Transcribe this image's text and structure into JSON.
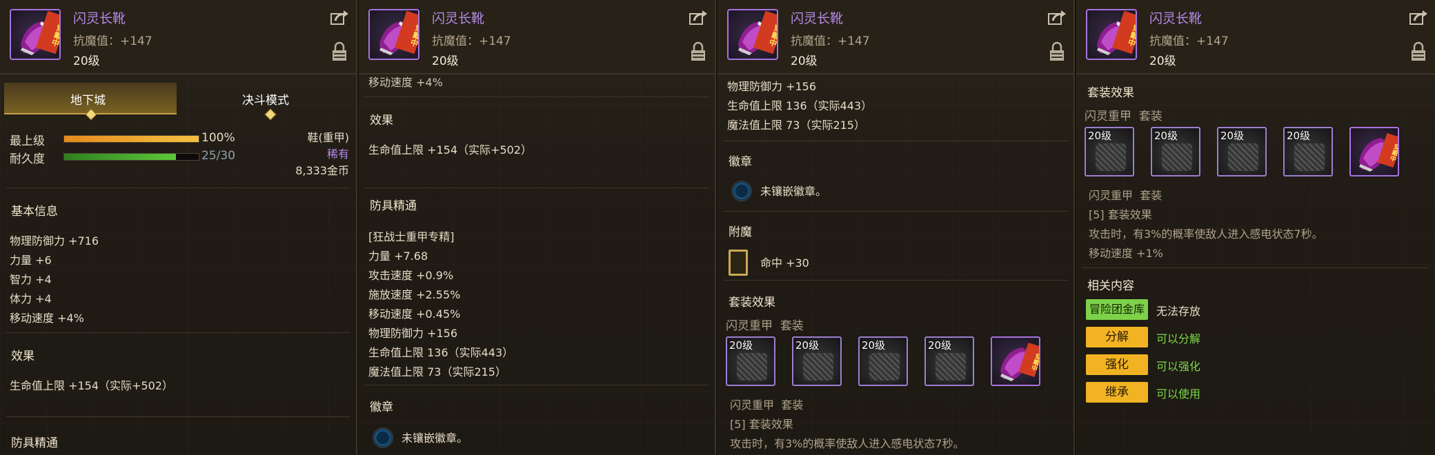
{
  "item": {
    "name": "闪灵长靴",
    "stat": "抗魔值：+147",
    "level": "20级",
    "equipped_tag": "穿戴中"
  },
  "colors": {
    "name": "#b58ae8",
    "rarity": "#b58ae8",
    "button_yellow": "#f2b323",
    "button_green": "#7ed14a",
    "positive_text": "#7cd94a"
  },
  "icons": [
    "shoe-icon",
    "share-icon",
    "lock-icon",
    "emblem-socket-icon",
    "enchant-card-icon"
  ],
  "panel1": {
    "tabs": [
      {
        "label": "地下城"
      },
      {
        "label": "决斗模式"
      }
    ],
    "grade_label": "最上级",
    "grade_value": "100%",
    "grade_fill": 1.0,
    "durability_label": "耐久度",
    "durability_value": "25/30",
    "durability_fill": 0.8333,
    "type": "鞋(重甲)",
    "rarity": "稀有",
    "price": "8,333金币",
    "basic_title": "基本信息",
    "basic_lines": [
      "物理防御力 +716",
      "力量 +6",
      "智力 +4",
      "体力 +4",
      "移动速度 +4%"
    ],
    "effect_title": "效果",
    "effect_line": "生命值上限 +154（实际+502）",
    "mastery_title": "防具精通"
  },
  "panel2": {
    "top_line": "移动速度 +4%",
    "effect_title": "效果",
    "effect_line": "生命值上限 +154（实际+502）",
    "mastery_title": "防具精通",
    "mastery_lines": [
      "[狂战士重甲专精]",
      "力量 +7.68",
      "攻击速度 +0.9%",
      "施放速度 +2.55%",
      "移动速度 +0.45%",
      "物理防御力 +156",
      "生命值上限 136（实际443）",
      "魔法值上限 73（实际215）"
    ],
    "emblem_title": "徽章",
    "emblem_line": "未镶嵌徽章。"
  },
  "panel3": {
    "top_lines": [
      "物理防御力 +156",
      "生命值上限 136（实际443）",
      "魔法值上限 73（实际215）"
    ],
    "emblem_title": "徽章",
    "emblem_line": "未镶嵌徽章。",
    "enchant_title": "附魔",
    "enchant_line": "命中 +30",
    "set_title": "套装效果",
    "set_name": "闪灵重甲",
    "set_suffix": "套装",
    "slot_levels": [
      "20级",
      "20级",
      "20级",
      "20级"
    ],
    "set_name2": "闪灵重甲",
    "set_suffix2": "套装",
    "set_effect": "[5] 套装效果",
    "set_desc": "攻击时，有3%的概率使敌人进入感电状态7秒。"
  },
  "panel4": {
    "set_title": "套装效果",
    "set_name": "闪灵重甲",
    "set_suffix": "套装",
    "slot_levels": [
      "20级",
      "20级",
      "20级",
      "20级"
    ],
    "set_name2": "闪灵重甲",
    "set_suffix2": "套装",
    "set_effect": "[5] 套装效果",
    "set_desc": "攻击时，有3%的概率使敌人进入感电状态7秒。",
    "set_bonus": "移动速度 +1%",
    "related_title": "相关内容",
    "account_btn": "冒险团金库",
    "account_status": "无法存放",
    "actions": [
      {
        "label": "分解",
        "status": "可以分解"
      },
      {
        "label": "强化",
        "status": "可以强化"
      },
      {
        "label": "继承",
        "status": "可以使用"
      }
    ]
  }
}
